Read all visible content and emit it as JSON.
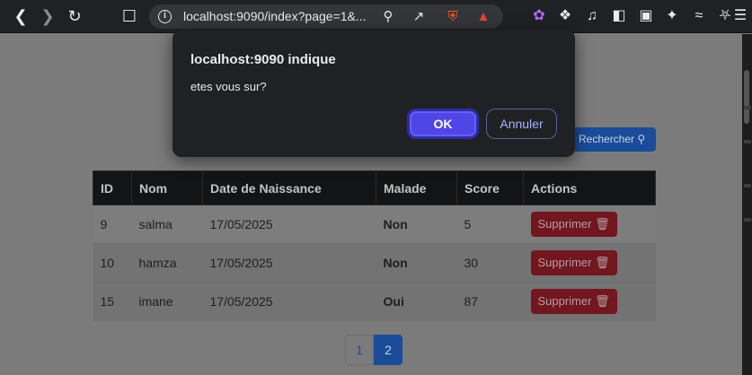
{
  "browser": {
    "url": "localhost:9090/index?page=1&...",
    "icons": [
      "back-icon",
      "forward-icon",
      "reload-icon",
      "bookmark-icon",
      "zoom-icon",
      "share-icon",
      "brave-shield-icon",
      "brave-rewards-icon",
      "extensions-icon",
      "media-icon",
      "sidebar-icon",
      "wallet-icon",
      "leo-icon",
      "vpn-icon",
      "menu-icon"
    ]
  },
  "search": {
    "label": "Rechercher"
  },
  "table": {
    "headers": [
      "ID",
      "Nom",
      "Date de Naissance",
      "Malade",
      "Score",
      "Actions"
    ],
    "rows": [
      {
        "id": "9",
        "nom": "salma",
        "date": "17/05/2025",
        "malade": "Non",
        "score": "5",
        "action": "Supprimer"
      },
      {
        "id": "10",
        "nom": "hamza",
        "date": "17/05/2025",
        "malade": "Non",
        "score": "30",
        "action": "Supprimer"
      },
      {
        "id": "15",
        "nom": "imane",
        "date": "17/05/2025",
        "malade": "Oui",
        "score": "87",
        "action": "Supprimer"
      }
    ]
  },
  "pagination": {
    "pages": [
      "1",
      "2"
    ],
    "current": "2"
  },
  "dialog": {
    "title": "localhost:9090 indique",
    "message": "etes vous sur?",
    "ok_label": "OK",
    "cancel_label": "Annuler"
  },
  "colors": {
    "accent": "#5046e5",
    "danger": "#dc3545",
    "primary": "#0d6efd",
    "success": "#198754"
  }
}
